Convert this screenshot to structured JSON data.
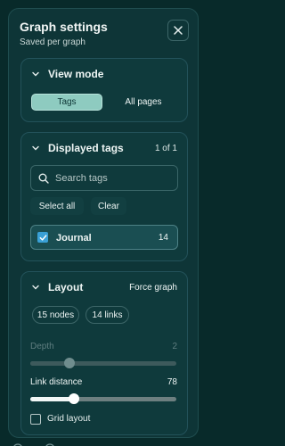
{
  "header": {
    "title": "Graph settings",
    "subtitle": "Saved per graph"
  },
  "view_mode": {
    "title": "View mode",
    "options": [
      {
        "label": "Tags",
        "selected": true
      },
      {
        "label": "All pages",
        "selected": false
      }
    ]
  },
  "displayed_tags": {
    "title": "Displayed tags",
    "count": "1 of 1",
    "search_placeholder": "Search tags",
    "select_all_label": "Select all",
    "clear_label": "Clear",
    "tags": [
      {
        "label": "Journal",
        "count": "14",
        "checked": true
      }
    ]
  },
  "layout": {
    "title": "Layout",
    "mode": "Force graph",
    "nodes_badge": "15 nodes",
    "links_badge": "14 links",
    "depth": {
      "label": "Depth",
      "value": "2",
      "fraction": 0.27,
      "disabled": true
    },
    "link_distance": {
      "label": "Link distance",
      "value": "78",
      "fraction": 0.3
    },
    "grid_layout": {
      "label": "Grid layout",
      "checked": false
    }
  },
  "colors": {
    "accent": "#8ecbc0",
    "checkbox": "#3aa0d6",
    "panel": "#0e3537",
    "background": "#082a2a"
  }
}
